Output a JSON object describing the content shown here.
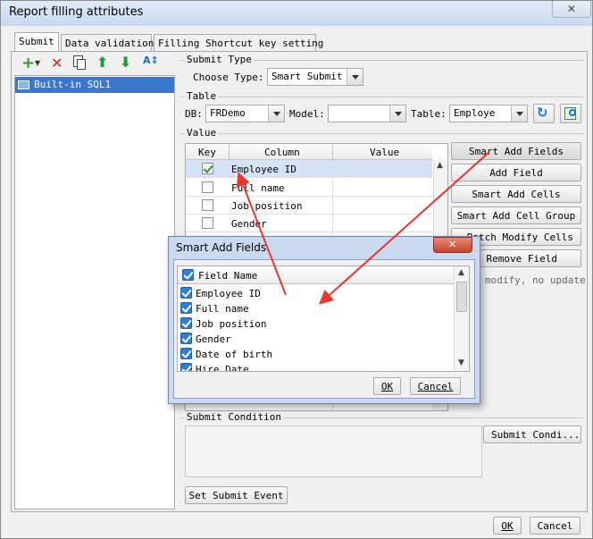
{
  "window": {
    "title": "Report filling attributes"
  },
  "tabs": [
    {
      "label": "Submit"
    },
    {
      "label": "Data validation"
    },
    {
      "label": "Filling Shortcut key setting"
    }
  ],
  "left_panel": {
    "items": [
      {
        "label": "Built-in SQL1"
      }
    ]
  },
  "submit_type": {
    "group_label": "Submit Type",
    "choose_label": "Choose Type:",
    "choose_value": "Smart Submit"
  },
  "table_section": {
    "group_label": "Table",
    "db_label": "DB:",
    "db_value": "FRDemo",
    "model_label": "Model:",
    "model_value": "",
    "table_label": "Table:",
    "table_value": "Employe"
  },
  "value_section": {
    "group_label": "Value",
    "headers": {
      "key": "Key",
      "column": "Column",
      "value": "Value"
    },
    "rows": [
      {
        "column": "Employee ID",
        "checked": true
      },
      {
        "column": "Full name",
        "checked": false
      },
      {
        "column": "Job position",
        "checked": false
      },
      {
        "column": "Gender",
        "checked": false
      }
    ],
    "buttons": {
      "smart_add_fields": "Smart Add Fields",
      "add_field": "Add Field",
      "smart_add_cells": "Smart Add Cells",
      "smart_add_cell_group": "Smart Add Cell Group",
      "batch_modify_cells": "Batch Modify Cells",
      "remove_field": "Remove Field"
    },
    "note": "modify, no update"
  },
  "submit_condition": {
    "group_label": "Submit Condition",
    "button": "Submit Condi..."
  },
  "set_submit_event": "Set Submit Event",
  "footer": {
    "ok": "OK",
    "cancel": "Cancel"
  },
  "dialog": {
    "title": "Smart Add Fields",
    "header": "Field Name",
    "fields": [
      "Employee ID",
      "Full name",
      "Job position",
      "Gender",
      "Date of birth",
      "Hire Date"
    ],
    "ok": "OK",
    "cancel": "Cancel"
  },
  "colors": {
    "accent": "#3399ff",
    "arrow": "#e8352e",
    "selection": "#3b76cf"
  }
}
